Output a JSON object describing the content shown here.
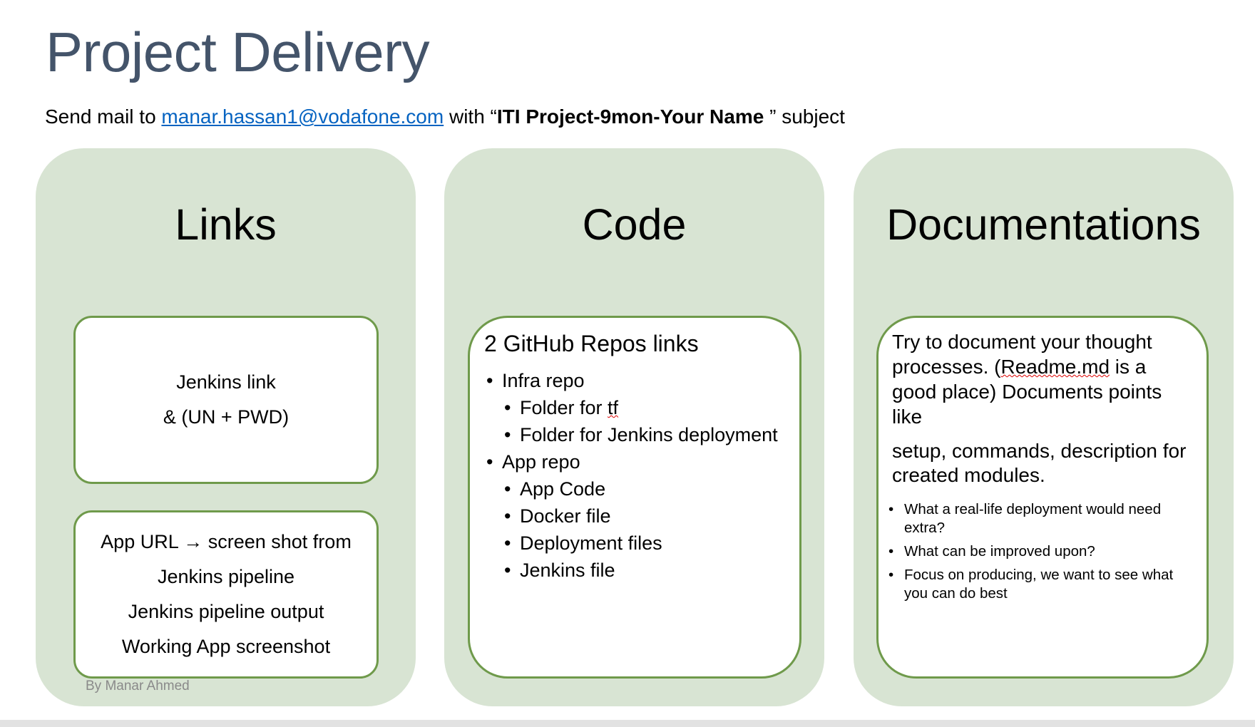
{
  "title": "Project Delivery",
  "subtitle": {
    "prefix": "Send mail to ",
    "email": "manar.hassan1@vodafone.com",
    "middle": " with “",
    "subject": "ITI Project-9mon-Your Name ",
    "suffix": "” subject"
  },
  "links": {
    "heading": "Links",
    "box1": [
      "Jenkins link",
      "& (UN + PWD)"
    ],
    "box2": [
      "App URL → screen shot from",
      "Jenkins pipeline",
      "Jenkins pipeline output",
      "Working App screenshot"
    ]
  },
  "code": {
    "heading": "Code",
    "box_title": "2 GitHub Repos links",
    "infra": "Infra repo",
    "infra_items": [
      "Folder for tf",
      "Folder for Jenkins deployment"
    ],
    "app": "App repo",
    "app_items": [
      "App Code",
      "Docker file",
      "Deployment files",
      "Jenkins file"
    ]
  },
  "docs": {
    "heading": "Documentations",
    "para1_a": "Try to document your thought processes. (",
    "para1_link": "Readme.md",
    "para1_b": " is a good place) Documents points like",
    "para2": "setup, commands, description for created modules.",
    "bullets": [
      "What a real-life deployment  would need extra?",
      "What can be improved upon?",
      "Focus on producing, we want to see what you can do best"
    ]
  },
  "author": "By Manar Ahmed"
}
